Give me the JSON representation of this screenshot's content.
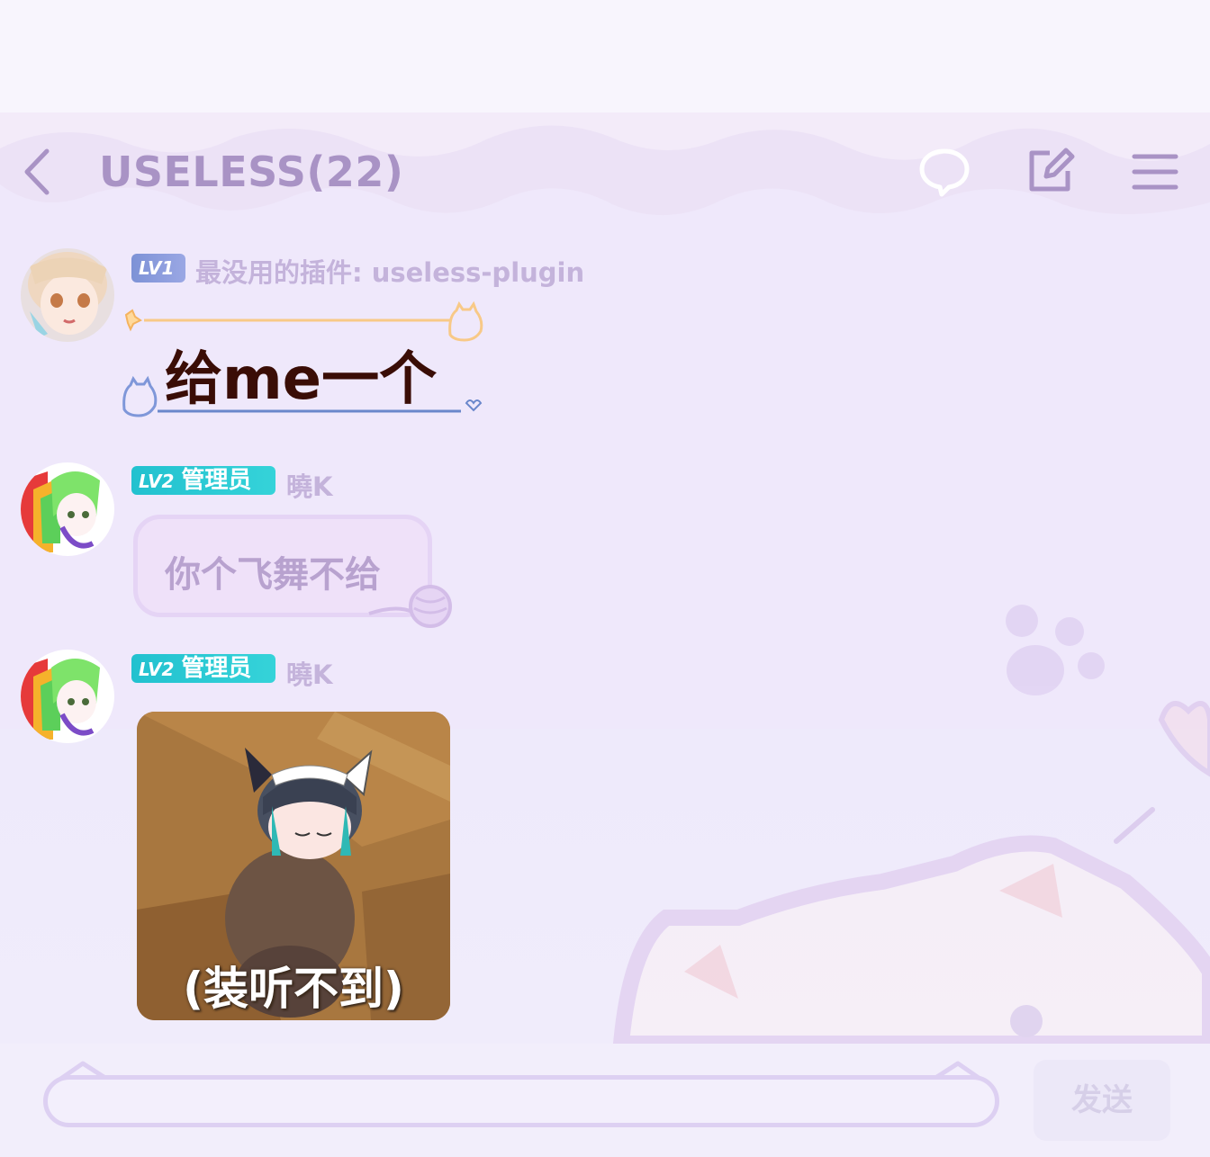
{
  "header": {
    "title": "USELESS(22)",
    "back_icon": "chevron-left-icon",
    "actions": [
      "chat-bubble-icon",
      "edit-icon",
      "menu-icon"
    ]
  },
  "messages": [
    {
      "level": "LV1",
      "role": "",
      "sender": "最没用的插件: useless-plugin",
      "type": "card",
      "text": "给me一个"
    },
    {
      "level": "LV2",
      "role": "管理员",
      "sender": "曉K",
      "type": "text",
      "text": "你个飞舞不给"
    },
    {
      "level": "LV2",
      "role": "管理员",
      "sender": "曉K",
      "type": "sticker",
      "text": "(装听不到)"
    }
  ],
  "composer": {
    "placeholder": "",
    "send_label": "发送"
  },
  "colors": {
    "accent": "#a993c5",
    "admin_badge": "#22c1cf",
    "lv1_badge": "#7d92d6"
  }
}
